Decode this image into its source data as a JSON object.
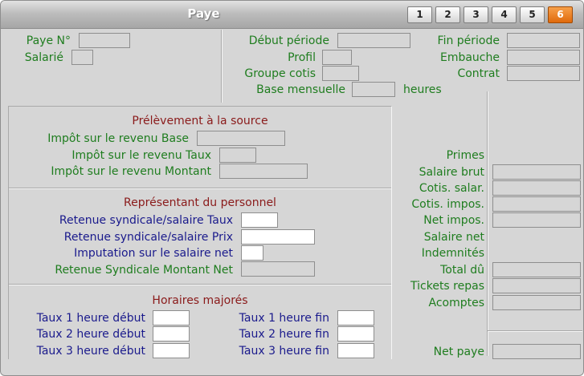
{
  "window": {
    "title": "Paye"
  },
  "tabs": [
    "1",
    "2",
    "3",
    "4",
    "5",
    "6"
  ],
  "active_tab": "6",
  "colors": {
    "label_green": "#1f7d1f",
    "label_blue": "#1a1a8c",
    "header_red": "#8a1a1a",
    "active_tab": "#f08020",
    "background": "#d6d6d6"
  },
  "top": {
    "paye_no": "Paye N°",
    "salarie": "Salarié",
    "debut_periode": "Début période",
    "profil": "Profil",
    "groupe_cotis": "Groupe cotis",
    "base_mensuelle": "Base mensuelle",
    "heures": "heures",
    "fin_periode": "Fin période",
    "embauche": "Embauche",
    "contrat": "Contrat"
  },
  "pas": {
    "header": "Prélèvement à la source",
    "base": "Impôt sur le revenu Base",
    "taux": "Impôt sur le revenu Taux",
    "montant": "Impôt sur le revenu Montant"
  },
  "representant": {
    "header": "Représentant du personnel",
    "taux": "Retenue syndicale/salaire Taux",
    "prix": "Retenue syndicale/salaire Prix",
    "imputation": "Imputation sur le salaire net",
    "montant_net": "Retenue Syndicale Montant Net"
  },
  "horaires": {
    "header": "Horaires majorés",
    "t1_debut": "Taux 1 heure début",
    "t2_debut": "Taux 2 heure début",
    "t3_debut": "Taux 3 heure début",
    "t1_fin": "Taux 1 heure fin",
    "t2_fin": "Taux 2 heure fin",
    "t3_fin": "Taux 3 heure fin"
  },
  "totals": {
    "primes": "Primes",
    "salaire_brut": "Salaire brut",
    "cotis_salar": "Cotis. salar.",
    "cotis_impos": "Cotis. impos.",
    "net_impos": "Net impos.",
    "salaire_net": "Salaire net",
    "indemnites": "Indemnités",
    "total_du": "Total dû",
    "tickets_repas": "Tickets repas",
    "acomptes": "Acomptes",
    "net_paye": "Net paye"
  }
}
